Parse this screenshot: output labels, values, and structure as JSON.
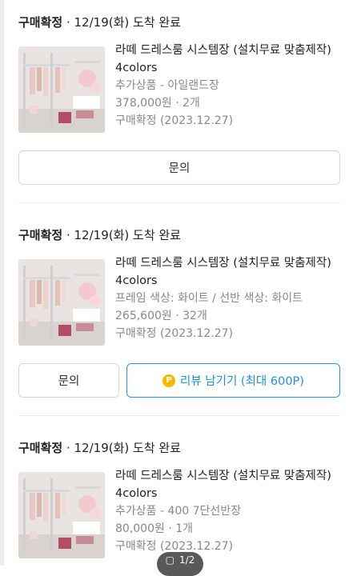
{
  "orders": [
    {
      "status": "구매확정",
      "delivery": "12/19(화) 도착 완료",
      "product": {
        "title": "라떼 드레스룸 시스템장 (설치무료 맞춤제작) 4colors",
        "option": "추가상품 - 아일랜드장",
        "price_qty": "378,000원 · 2개",
        "confirm": "구매확정 (2023.12.27)"
      },
      "buttons": {
        "inquiry": "문의"
      }
    },
    {
      "status": "구매확정",
      "delivery": "12/19(화) 도착 완료",
      "product": {
        "title": "라떼 드레스룸 시스템장 (설치무료 맞춤제작) 4colors",
        "option": "프레임 색상: 화이트 / 선반 색상: 화이트",
        "price_qty": "265,600원 · 32개",
        "confirm": "구매확정 (2023.12.27)"
      },
      "buttons": {
        "inquiry": "문의",
        "review": "리뷰 남기기 (최대 600P)",
        "coin_label": "P"
      }
    },
    {
      "status": "구매확정",
      "delivery": "12/19(화) 도착 완료",
      "product": {
        "title": "라떼 드레스룸 시스템장 (설치무료 맞춤제작) 4colors",
        "option": "추가상품 - 400 7단선반장",
        "price_qty": "80,000원 · 1개",
        "confirm": "구매확정 (2023.12.27)"
      }
    }
  ],
  "pager": {
    "label": "1/2"
  },
  "colors": {
    "accent": "#1f97e8",
    "coin": "#f5b700"
  }
}
